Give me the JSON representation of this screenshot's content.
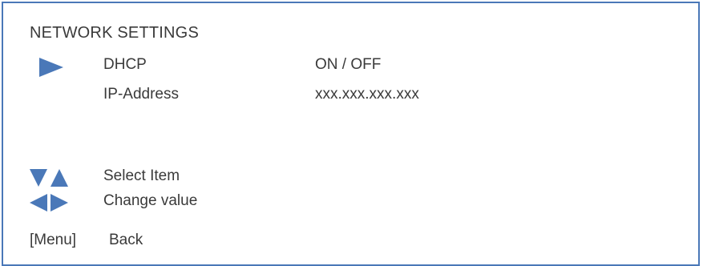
{
  "screen": {
    "title": "NETWORK SETTINGS",
    "accent_color": "#4a78b8"
  },
  "menu": {
    "items": [
      {
        "label": "DHCP",
        "value": "ON / OFF",
        "selected": true
      },
      {
        "label": "IP-Address",
        "value": "xxx.xxx.xxx.xxx",
        "selected": false
      }
    ]
  },
  "help": {
    "select": {
      "icon": "down-up-triangles-icon",
      "label": "Select Item"
    },
    "change": {
      "icon": "left-right-triangles-icon",
      "label": "Change value"
    },
    "back": {
      "key": "[Menu]",
      "label": "Back"
    }
  }
}
